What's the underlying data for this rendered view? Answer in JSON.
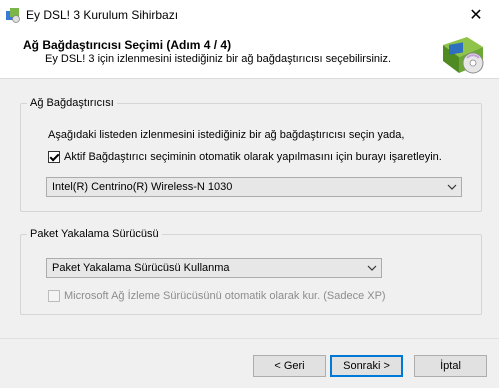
{
  "window": {
    "title": "Ey DSL! 3 Kurulum Sihirbazı",
    "close_glyph": "✕",
    "app_icon": "installer-app-icon"
  },
  "header": {
    "title": "Ağ Bağdaştırıcısı Seçimi (Adım 4 / 4)",
    "subtitle": "Ey DSL! 3 için izlenmesini istediğiniz bir ağ bağdaştırıcısı seçebilirsiniz.",
    "graphic": "network-disc-install-icon"
  },
  "adapter_group": {
    "legend": "Ağ Bağdaştırıcısı",
    "description": "Aşağıdaki listeden izlenmesini istediğiniz bir ağ bağdaştırıcısı seçin yada,",
    "auto_checkbox": {
      "label": "Aktif Bağdaştırıcı seçiminin otomatik olarak yapılmasını için burayı işaretleyin.",
      "checked": true
    },
    "adapter_select": {
      "value": "Intel(R) Centrino(R) Wireless-N 1030"
    }
  },
  "capture_group": {
    "legend": "Paket Yakalama Sürücüsü",
    "driver_select": {
      "value": "Paket Yakalama Sürücüsü Kullanma"
    },
    "ms_checkbox": {
      "label": "Microsoft Ağ İzleme Sürücüsünü otomatik olarak kur. (Sadece XP)",
      "checked": false,
      "enabled": false
    }
  },
  "buttons": {
    "back": "< Geri",
    "next": "Sonraki >",
    "cancel": "İptal"
  },
  "colors": {
    "window_bg": "#f0f0f0",
    "header_bg": "#ffffff",
    "focus_border": "#0078d7"
  }
}
